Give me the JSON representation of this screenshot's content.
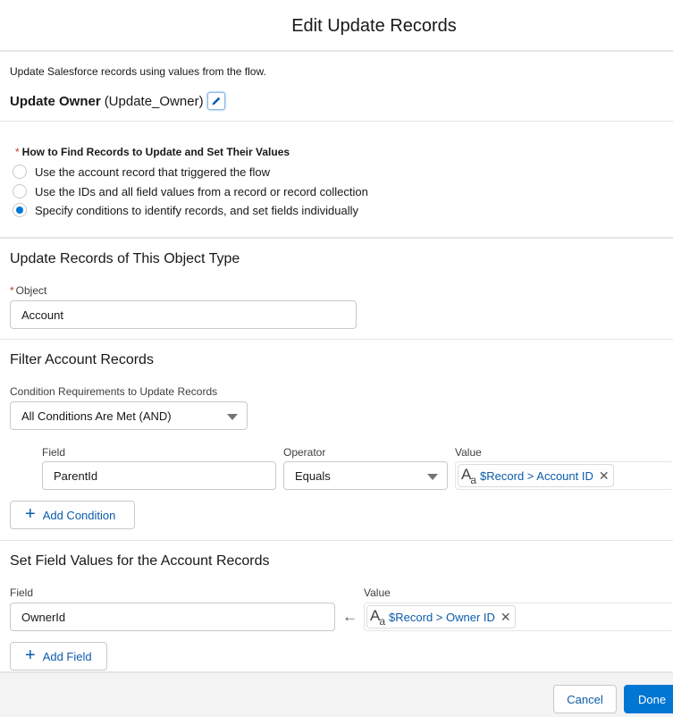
{
  "header": {
    "title": "Edit Update Records"
  },
  "description": "Update Salesforce records using values from the flow.",
  "element": {
    "label": "Update Owner",
    "api_name": "(Update_Owner)",
    "edit_icon": "pencil-icon"
  },
  "how_to_find": {
    "label": "How to Find Records to Update and Set Their Values",
    "required_marker": "*",
    "options": [
      {
        "label": "Use the account record that triggered the flow",
        "checked": false
      },
      {
        "label": "Use the IDs and all field values from a record or record collection",
        "checked": false
      },
      {
        "label": "Specify conditions to identify records, and set fields individually",
        "checked": true
      }
    ]
  },
  "object_section": {
    "title": "Update Records of This Object Type",
    "object_label": "Object",
    "required_marker": "*",
    "object_value": "Account"
  },
  "filter_section": {
    "title": "Filter Account Records",
    "condition_req_label": "Condition Requirements to Update Records",
    "condition_req_value": "All Conditions Are Met (AND)",
    "columns": {
      "field": "Field",
      "operator": "Operator",
      "value": "Value"
    },
    "conditions": [
      {
        "field": "ParentId",
        "operator": "Equals",
        "value": "$Record > Account ID",
        "value_icon": "text-type-icon"
      }
    ],
    "add_condition_label": "Add Condition"
  },
  "set_fields_section": {
    "title": "Set Field Values for the Account Records",
    "columns": {
      "field": "Field",
      "value": "Value"
    },
    "assignments": [
      {
        "field": "OwnerId",
        "value": "$Record > Owner ID",
        "value_icon": "text-type-icon"
      }
    ],
    "add_field_label": "Add Field"
  },
  "footer": {
    "cancel_label": "Cancel",
    "done_label": "Done"
  },
  "colors": {
    "brand": "#0176d3",
    "link": "#0b5cab",
    "required": "#c23934"
  }
}
